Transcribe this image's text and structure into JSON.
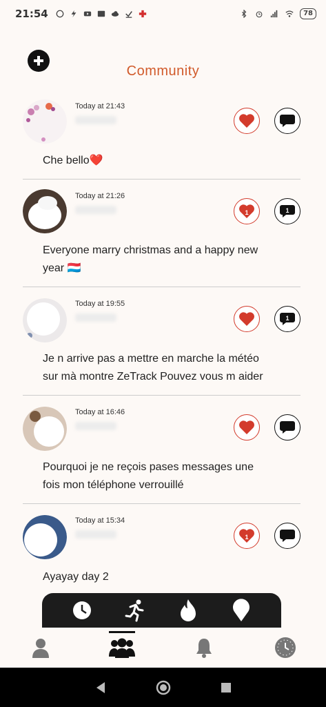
{
  "status_bar": {
    "time": "21:54",
    "battery": "78",
    "icons_left": [
      "whatsapp-icon",
      "bolt-icon",
      "youtube-icon",
      "news-icon",
      "cloud-icon",
      "check-icon",
      "game-icon"
    ],
    "icons_right": [
      "bluetooth-icon",
      "alarm-icon",
      "signal-icon",
      "wifi-icon"
    ]
  },
  "header": {
    "title": "Community",
    "add_icon": "plus-circle-icon"
  },
  "colors": {
    "accent": "#d15a2a",
    "like": "#d33b2c",
    "dark": "#111111",
    "background": "#fdf9f6"
  },
  "posts": [
    {
      "timestamp": "Today at 21:43",
      "message_lines": [
        "Che bello❤️"
      ],
      "likes": "",
      "comments": ""
    },
    {
      "timestamp": "Today at 21:26",
      "message_lines": [
        "Everyone marry christmas and a happy new",
        "year 🇱🇺"
      ],
      "likes": "1",
      "comments": "1"
    },
    {
      "timestamp": "Today at 19:55",
      "message_lines": [
        "Je n arrive pas a mettre en marche la météo",
        "sur mà montre ZeTrack Pouvez vous m aider"
      ],
      "likes": "",
      "comments": "1"
    },
    {
      "timestamp": "Today at 16:46",
      "message_lines": [
        "Pourquoi je ne reçois pases messages une",
        "fois mon téléphone verrouillé"
      ],
      "likes": "",
      "comments": ""
    },
    {
      "timestamp": "Today at 15:34",
      "message_lines": [
        "Ayayay day 2"
      ],
      "likes": "1",
      "comments": ""
    }
  ],
  "float_tabs": [
    "clock-icon",
    "running-icon",
    "flame-icon",
    "location-pin-icon"
  ],
  "bottom_nav": [
    {
      "icon": "profile-icon",
      "active": false
    },
    {
      "icon": "community-icon",
      "active": true
    },
    {
      "icon": "bell-icon",
      "active": false
    },
    {
      "icon": "watch-icon",
      "active": false
    }
  ]
}
